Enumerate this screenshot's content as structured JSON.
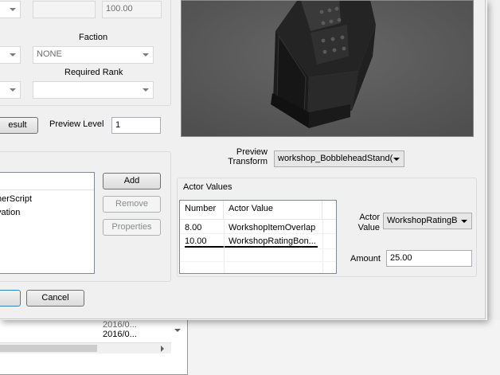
{
  "top": {
    "value_field": "100.00"
  },
  "faction": {
    "label": "Faction",
    "value": "NONE"
  },
  "required_rank": {
    "label": "Required Rank",
    "value": ""
  },
  "result_button": "esult",
  "preview_level": {
    "label": "Preview Level",
    "value": "1"
  },
  "scripts": {
    "header": "",
    "items": [
      "nerScript",
      "vation"
    ],
    "add": "Add",
    "remove": "Remove",
    "properties": "Properties"
  },
  "preview_transform": {
    "label_line1": "Preview",
    "label_line2": "Transform",
    "value": "workshop_BobbleheadStand("
  },
  "actor_values": {
    "group_label": "Actor Values",
    "columns": [
      "Number",
      "Actor Value"
    ],
    "rows": [
      {
        "number": "8.00",
        "actor_value": "WorkshopItemOverlap"
      },
      {
        "number": "10.00",
        "actor_value": "WorkshopRatingBon..."
      }
    ],
    "actor_value_label_1": "Actor",
    "actor_value_label_2": "Value",
    "actor_value_select": "WorkshopRatingB",
    "amount_label": "Amount",
    "amount_value": "25.00"
  },
  "footer": {
    "ok": "",
    "cancel": "Cancel"
  },
  "background_window": {
    "cell1": "2016/0...",
    "cell2": "2016/0..."
  },
  "icons": [
    "chevron-down-icon",
    "scroll-right-icon"
  ]
}
